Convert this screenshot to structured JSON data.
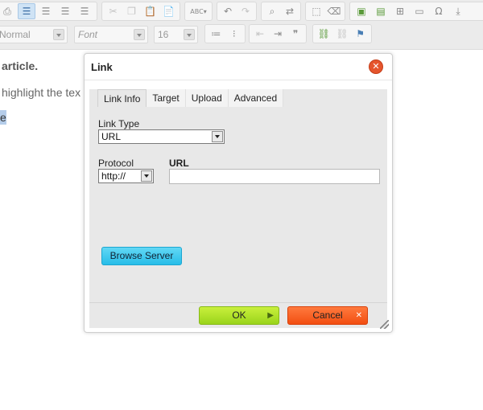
{
  "toolbar": {
    "row1_groups": [
      {
        "icons": [
          "preview-icon",
          "align-left-icon",
          "align-center-icon",
          "align-right-icon",
          "align-justify-icon"
        ],
        "active": [
          1
        ]
      },
      {
        "icons": [
          "cut-icon",
          "copy-icon",
          "paste-icon",
          "paste-text-icon"
        ]
      },
      {
        "icons": [
          "spellcheck-icon"
        ],
        "glyph": "ABC▾"
      },
      {
        "icons": [
          "undo-icon",
          "redo-icon"
        ]
      },
      {
        "icons": [
          "find-icon",
          "replace-icon"
        ]
      },
      {
        "icons": [
          "select-all-icon",
          "remove-format-icon"
        ]
      },
      {
        "icons": [
          "image-icon",
          "flash-icon",
          "table-icon",
          "horizontal-rule-icon",
          "special-char-icon",
          "page-break-icon"
        ]
      }
    ],
    "style_combo": "Normal",
    "font_combo": "Font",
    "size_combo": "16",
    "row2_icons": [
      "numbered-list-icon",
      "bulleted-list-icon",
      "outdent-icon",
      "indent-icon",
      "blockquote-icon",
      "link-icon",
      "unlink-icon",
      "anchor-icon"
    ]
  },
  "editor": {
    "line1": "article.",
    "line2": "highlight the tex",
    "selection": "e"
  },
  "dialog": {
    "title": "Link",
    "tabs": [
      "Link Info",
      "Target",
      "Upload",
      "Advanced"
    ],
    "active_tab": "Link Info",
    "link_type_label": "Link Type",
    "link_type_value": "URL",
    "protocol_label": "Protocol",
    "protocol_value": "http://",
    "url_label": "URL",
    "url_value": "",
    "browse_label": "Browse Server",
    "ok_label": "OK",
    "cancel_label": "Cancel"
  },
  "colors": {
    "ok_button": "#a8e02a",
    "cancel_button": "#f65a1c",
    "browse_button": "#38c6ee",
    "close_button": "#e5552d"
  }
}
